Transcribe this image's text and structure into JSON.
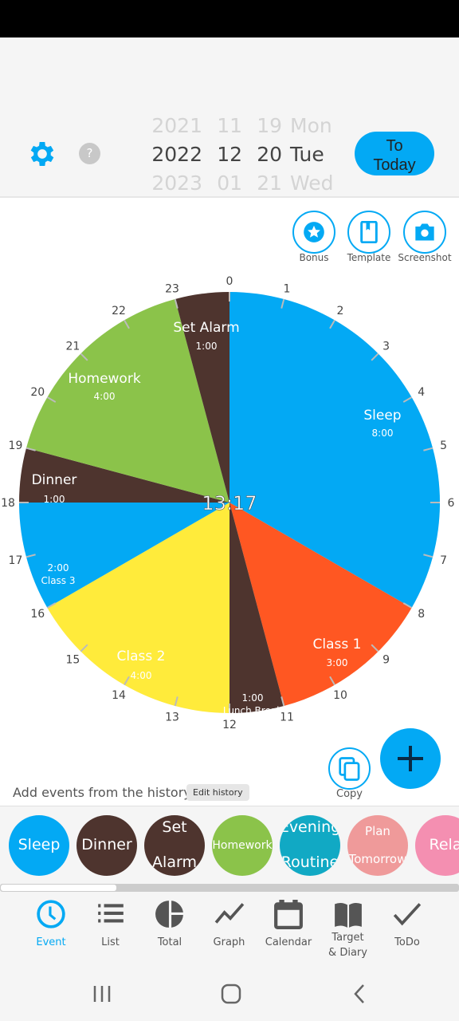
{
  "date_picker": {
    "prev": [
      "2021",
      "11",
      "19",
      "Mon"
    ],
    "current": [
      "2022",
      "12",
      "20",
      "Tue"
    ],
    "next": [
      "2023",
      "01",
      "21",
      "Wed"
    ]
  },
  "header": {
    "to_today_line1": "To",
    "to_today_line2": "Today",
    "settings_icon": "gear-icon",
    "help_icon": "question-icon"
  },
  "tools": [
    {
      "label": "Bonus",
      "icon": "star-icon"
    },
    {
      "label": "Template",
      "icon": "book-icon"
    },
    {
      "label": "Screenshot",
      "icon": "camera-icon"
    }
  ],
  "clock": {
    "current_time": "13:17",
    "hour_labels": [
      "0",
      "1",
      "2",
      "3",
      "4",
      "5",
      "6",
      "7",
      "8",
      "9",
      "10",
      "11",
      "12",
      "13",
      "14",
      "15",
      "16",
      "17",
      "18",
      "19",
      "20",
      "21",
      "22",
      "23"
    ],
    "events": [
      {
        "name": "Sleep",
        "duration": "8:00",
        "start": 0,
        "end": 8,
        "color": "#03a9f4"
      },
      {
        "name": "Class 1",
        "duration": "3:00",
        "start": 8,
        "end": 11,
        "color": "#ff5722"
      },
      {
        "name": "Lunch Break",
        "duration": "1:00",
        "start": 11,
        "end": 12,
        "color": "#4e342e"
      },
      {
        "name": "Class 2",
        "duration": "4:00",
        "start": 12,
        "end": 16,
        "color": "#ffeb3b"
      },
      {
        "name": "Class 3",
        "duration": "2:00",
        "start": 16,
        "end": 18,
        "color": "#03a9f4"
      },
      {
        "name": "Dinner",
        "duration": "1:00",
        "start": 18,
        "end": 19,
        "color": "#4e342e"
      },
      {
        "name": "Homework",
        "duration": "4:00",
        "start": 19,
        "end": 23,
        "color": "#8bc34a"
      },
      {
        "name": "Set Alarm",
        "duration": "1:00",
        "start": 23,
        "end": 24,
        "color": "#4e342e"
      }
    ]
  },
  "actions": {
    "copy_label": "Copy",
    "add_icon": "plus-icon"
  },
  "history": {
    "label": "Add events from the history",
    "edit_label": "Edit history",
    "items": [
      {
        "l1": "Sleep",
        "l2": "",
        "color": "#03a9f4",
        "size": 19
      },
      {
        "l1": "Dinner",
        "l2": "",
        "color": "#4e342e",
        "size": 19
      },
      {
        "l1": "Set",
        "l2": "Alarm",
        "color": "#4e342e",
        "size": 19
      },
      {
        "l1": "Homework",
        "l2": "",
        "color": "#8bc34a",
        "size": 14
      },
      {
        "l1": "Evening",
        "l2": "Routine",
        "color": "#11a9c4",
        "size": 19
      },
      {
        "l1": "Plan",
        "l2": "Tomorrow",
        "color": "#ef9a9a",
        "size": 15
      },
      {
        "l1": "Rela",
        "l2": "",
        "color": "#f48fb1",
        "size": 19
      }
    ]
  },
  "nav": [
    {
      "label": "Event",
      "active": true
    },
    {
      "label": "List"
    },
    {
      "label": "Total"
    },
    {
      "label": "Graph"
    },
    {
      "label": "Calendar"
    },
    {
      "label": "Target & Diary"
    },
    {
      "label": "ToDo"
    }
  ],
  "colors": {
    "accent": "#03a9f4"
  }
}
